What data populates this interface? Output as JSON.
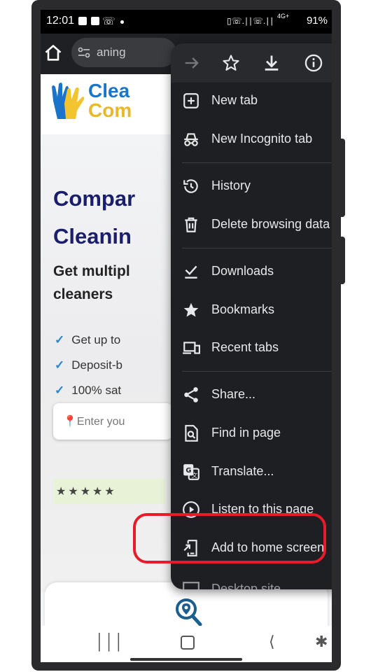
{
  "status_bar": {
    "time": "12:01",
    "battery": "91%",
    "network": "4G+"
  },
  "toolbar": {
    "url_fragment": "aning"
  },
  "page": {
    "logo_line1": "Clea",
    "logo_line2": "Com",
    "hero_title_1": "Compar",
    "hero_title_2": "Cleanin",
    "hero_sub_1": "Get multipl",
    "hero_sub_2": "cleaners",
    "checks": [
      "Get up to",
      "Deposit-b",
      "100% sat"
    ],
    "search_placeholder": "📍Enter you",
    "stars": "★★★★★"
  },
  "menu": {
    "items": [
      {
        "label": "New tab",
        "icon": "new-tab-icon"
      },
      {
        "label": "New Incognito tab",
        "icon": "incognito-icon"
      },
      {
        "label": "History",
        "icon": "history-icon"
      },
      {
        "label": "Delete browsing data",
        "icon": "trash-icon"
      },
      {
        "label": "Downloads",
        "icon": "downloads-icon"
      },
      {
        "label": "Bookmarks",
        "icon": "star-icon"
      },
      {
        "label": "Recent tabs",
        "icon": "recent-tabs-icon"
      },
      {
        "label": "Share...",
        "icon": "share-icon"
      },
      {
        "label": "Find in page",
        "icon": "find-icon"
      },
      {
        "label": "Translate...",
        "icon": "translate-icon"
      },
      {
        "label": "Listen to this page",
        "icon": "play-icon"
      },
      {
        "label": "Add to home screen",
        "icon": "add-home-icon"
      },
      {
        "label": "Desktop site",
        "icon": "desktop-icon"
      }
    ]
  },
  "colors": {
    "menu_bg": "#1e1f22",
    "highlight": "#e51d2b",
    "whatsapp": "#36c45a",
    "brand_blue": "#1a74c9",
    "brand_yellow": "#e9b72a"
  }
}
